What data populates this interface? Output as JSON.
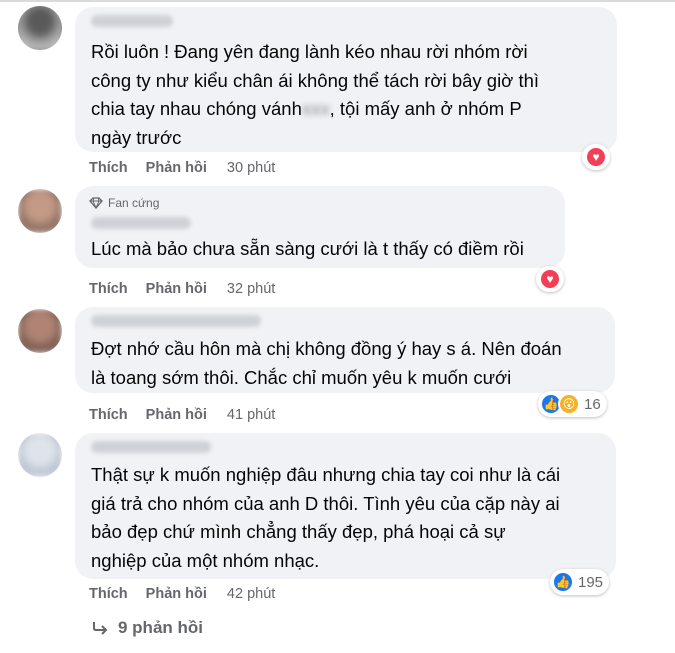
{
  "comments": [
    {
      "badge": "",
      "lines": [
        "Rồi luôn ! Đang yên đang lành kéo nhau rời nhóm rời",
        "công ty như kiểu chân ái không thể tách rời bây giờ thì",
        "chia tay nhau chóng vánh",
        "ngày trước"
      ],
      "line3_tail": ", tội mấy anh ở nhóm P",
      "like_label": "Thích",
      "reply_label": "Phản hồi",
      "time": "30 phút",
      "reaction": "heart",
      "reaction_count": ""
    },
    {
      "badge": "Fan cứng",
      "lines": [
        "Lúc mà bảo chưa sẵn sàng cưới là t thấy có điềm rồi"
      ],
      "like_label": "Thích",
      "reply_label": "Phản hồi",
      "time": "32 phút",
      "reaction": "heart",
      "reaction_count": ""
    },
    {
      "badge": "",
      "lines": [
        "Đợt nhớ cầu hôn mà chị không đồng ý hay s á. Nên đoán",
        "là toang sớm thôi. Chắc chỉ muốn yêu k muốn cưới"
      ],
      "like_label": "Thích",
      "reply_label": "Phản hồi",
      "time": "41 phút",
      "reaction": "like+wow",
      "reaction_count": "16"
    },
    {
      "badge": "",
      "lines": [
        "Thật sự k muốn nghiệp đâu nhưng chia tay coi như là cái",
        "giá trả cho nhóm của anh D thôi. Tình yêu của cặp này ai",
        "bảo đẹp chứ mình chẳng thấy đẹp, phá hoại cả sự",
        "nghiệp của một nhóm nhạc."
      ],
      "like_label": "Thích",
      "reply_label": "Phản hồi",
      "time": "42 phút",
      "reaction": "like",
      "reaction_count": "195"
    }
  ],
  "more_replies": "9 phản hồi",
  "icons": {
    "heart": "heart-reaction-icon",
    "like": "like-reaction-icon",
    "wow": "wow-reaction-icon",
    "badge": "diamond-icon",
    "reply": "reply-arrow-icon"
  },
  "colors": {
    "bubble": "#f0f2f5",
    "heart": "#f33e58",
    "like": "#1877f2",
    "wow": "#f7b125",
    "meta": "#65676b"
  }
}
